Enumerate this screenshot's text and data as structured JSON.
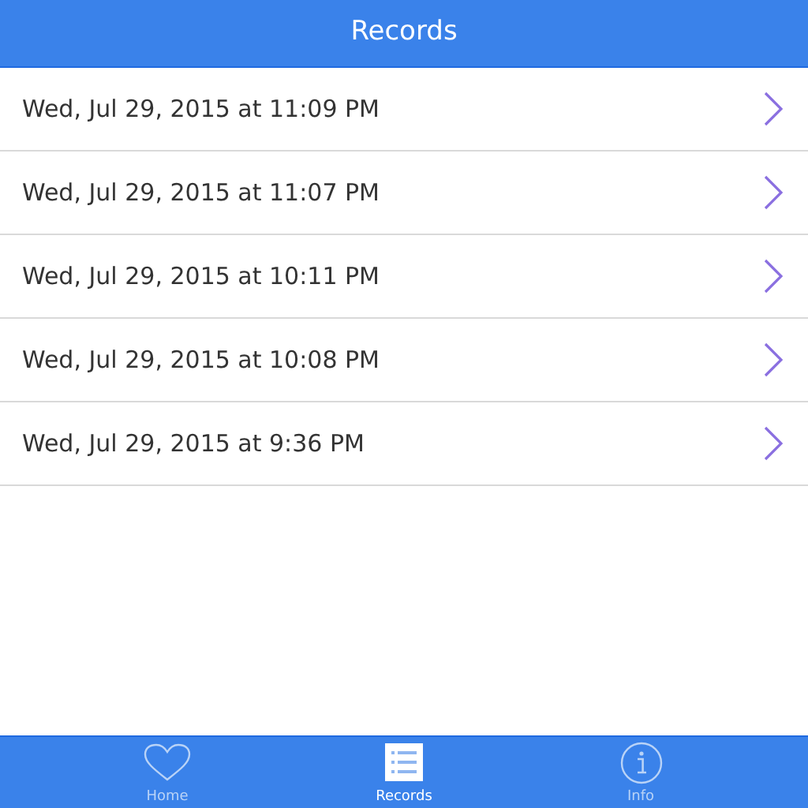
{
  "nav_bar": {
    "title": "Records"
  },
  "records": [
    {
      "label": "Wed, Jul 29, 2015 at 11:09 PM"
    },
    {
      "label": "Wed, Jul 29, 2015 at 11:07 PM"
    },
    {
      "label": "Wed, Jul 29, 2015 at 10:11 PM"
    },
    {
      "label": "Wed, Jul 29, 2015 at 10:08 PM"
    },
    {
      "label": "Wed, Jul 29, 2015 at 9:36 PM"
    }
  ],
  "tab_bar": [
    {
      "label": "Home",
      "selected": false
    },
    {
      "label": "Records",
      "selected": true
    },
    {
      "label": "Info",
      "selected": false
    }
  ]
}
